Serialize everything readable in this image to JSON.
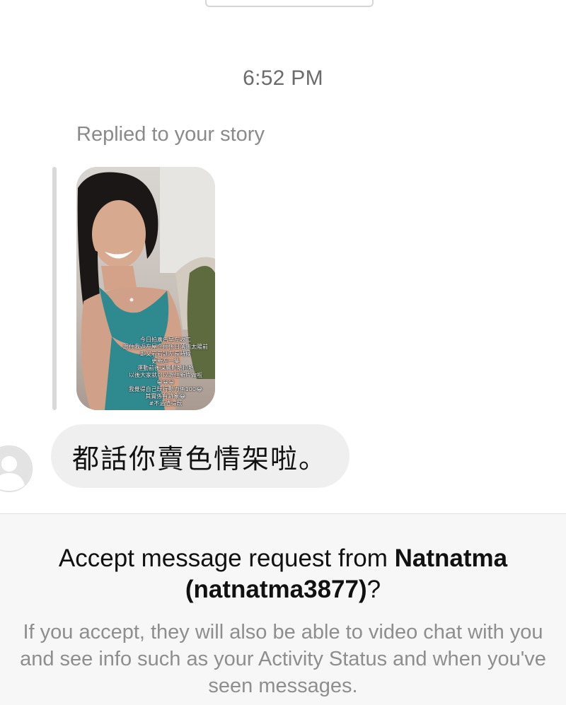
{
  "thread": {
    "timestamp": "6:52 PM",
    "reply_label": "Replied to your story",
    "story": {
      "caption_lines": [
        "今日拍廣告早左收工",
        "跟住我返左屋企仲係日落無太陽前",
        "即又岩岩訓左長時候",
        "更新左一集",
        "運動前後深層鬆筋拉筋",
        "以後大家就可以跟住新片做啦",
        "😀😀😀",
        "我覺得自己既行動力係100😂",
        "其實係有跡象😂",
        "#不過值得既"
      ]
    },
    "message_text": "都話你賣色情架啦。"
  },
  "request": {
    "title_prefix": "Accept message request from ",
    "name": "Natnatma",
    "username": "(natnatma3877)",
    "title_suffix": "?",
    "info_lines": [
      "If you accept, they will also be able to video chat with you",
      "and see info such as your Activity Status and when you've",
      "seen messages."
    ]
  }
}
